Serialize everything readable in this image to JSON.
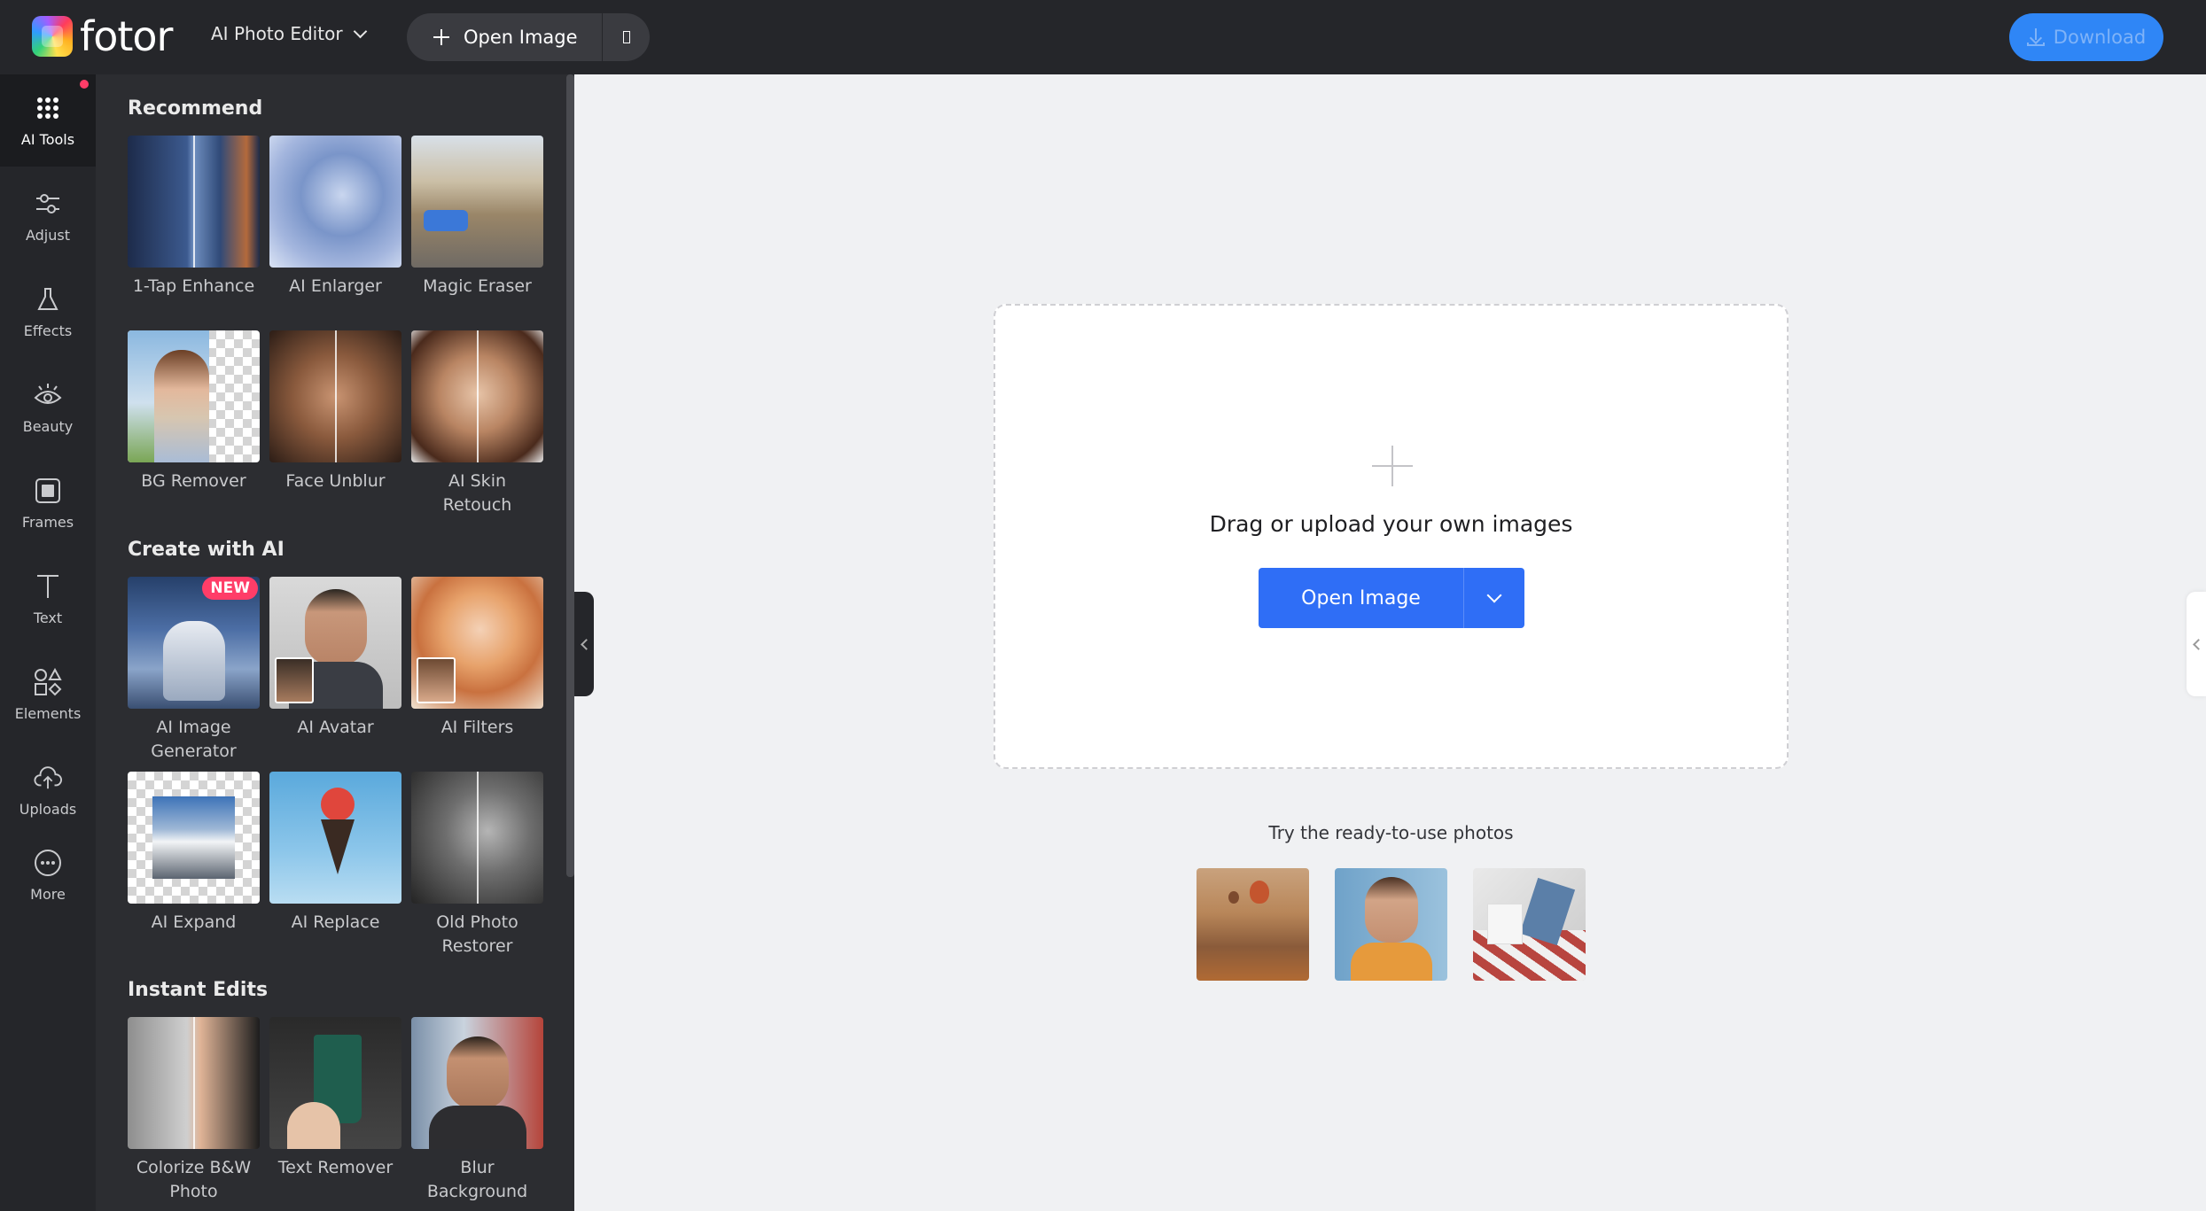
{
  "app": {
    "logo_text": "fotor",
    "product_menu": "AI Photo Editor",
    "open_image": "Open Image",
    "download": "Download",
    "colors": {
      "accent": "#2f6ef6",
      "download": "#2f86f6",
      "topbar": "#25262a",
      "panel": "#2c2d31",
      "badge": "#ff3d68"
    }
  },
  "rail": {
    "items": [
      {
        "label": "AI Tools",
        "icon": "dots-grid-icon"
      },
      {
        "label": "Adjust",
        "icon": "sliders-icon"
      },
      {
        "label": "Effects",
        "icon": "flask-icon"
      },
      {
        "label": "Beauty",
        "icon": "eye-icon"
      },
      {
        "label": "Frames",
        "icon": "frame-icon"
      },
      {
        "label": "Text",
        "icon": "text-icon"
      },
      {
        "label": "Elements",
        "icon": "shapes-icon"
      },
      {
        "label": "Uploads",
        "icon": "cloud-upload-icon"
      },
      {
        "label": "More",
        "icon": "more-icon"
      }
    ]
  },
  "panel": {
    "sections": [
      {
        "title": "Recommend",
        "tools": [
          "1-Tap Enhance",
          "AI Enlarger",
          "Magic Eraser",
          "BG Remover",
          "Face Unblur",
          "AI Skin\nRetouch"
        ]
      },
      {
        "title": "Create with AI",
        "tools": [
          "AI Image\nGenerator",
          "AI Avatar",
          "AI Filters",
          "AI Expand",
          "AI Replace",
          "Old Photo\nRestorer"
        ]
      },
      {
        "title": "Instant Edits",
        "tools": [
          "Colorize B&W\nPhoto",
          "Text Remover",
          "Blur\nBackground"
        ]
      }
    ],
    "new_badge": "NEW"
  },
  "canvas": {
    "drop_text": "Drag or upload your own images",
    "open_button": "Open Image",
    "ready_text": "Try the ready-to-use photos"
  }
}
